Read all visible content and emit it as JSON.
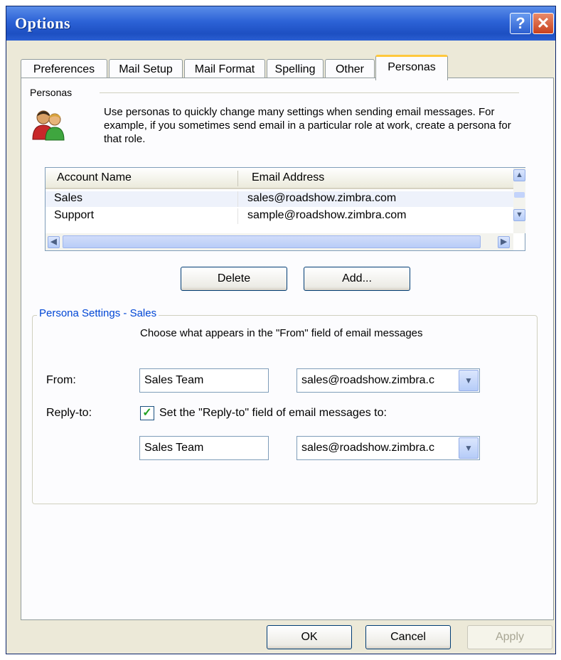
{
  "window": {
    "title": "Options",
    "help_glyph": "?",
    "close_glyph": "✕"
  },
  "tabs": [
    {
      "label": "Preferences"
    },
    {
      "label": "Mail Setup"
    },
    {
      "label": "Mail Format"
    },
    {
      "label": "Spelling"
    },
    {
      "label": "Other"
    },
    {
      "label": "Personas",
      "active": true
    }
  ],
  "personas": {
    "group_label": "Personas",
    "description": "Use personas to quickly change many settings when sending email messages. For example, if you sometimes send email in a particular role at work, create a persona for that role.",
    "icon": "people-icon",
    "list": {
      "columns": [
        "Account Name",
        "Email Address"
      ],
      "rows": [
        {
          "name": "Sales",
          "email": "sales@roadshow.zimbra.com",
          "selected": true
        },
        {
          "name": "Support",
          "email": "sample@roadshow.zimbra.com",
          "selected": false
        }
      ]
    },
    "delete_label": "Delete",
    "add_label": "Add..."
  },
  "settings": {
    "title": "Persona Settings - Sales",
    "instruction": "Choose what appears in the \"From\" field of email messages",
    "from_label": "From:",
    "from_name": "Sales Team",
    "from_email": "sales@roadshow.zimbra.c",
    "reply_label": "Reply-to:",
    "reply_checkbox_label": "Set the \"Reply-to\" field of email messages to:",
    "reply_checked": true,
    "reply_name": "Sales Team",
    "reply_email": "sales@roadshow.zimbra.c"
  },
  "footer": {
    "ok_label": "OK",
    "cancel_label": "Cancel",
    "apply_label": "Apply"
  },
  "colors": {
    "title_bar": "#2c62d6",
    "tab_highlight": "#ffc83c",
    "group_title": "#0046d5",
    "check_mark": "#21a121"
  }
}
